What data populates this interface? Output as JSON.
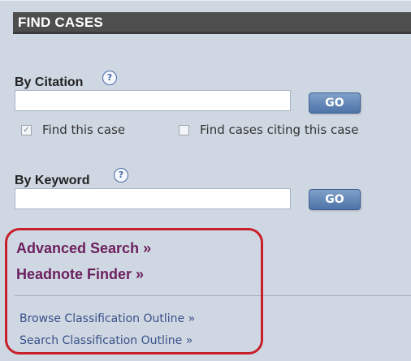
{
  "header": {
    "title": "FIND CASES"
  },
  "by_citation": {
    "label": "By Citation",
    "help_glyph": "?",
    "input_value": "",
    "go_label": "GO",
    "options": [
      {
        "label": "Find this case",
        "checked": true
      },
      {
        "label": "Find cases citing this case",
        "checked": false
      }
    ]
  },
  "by_keyword": {
    "label": "By Keyword",
    "help_glyph": "?",
    "input_value": "",
    "go_label": "GO"
  },
  "links": {
    "advanced_search": "Advanced Search »",
    "headnote_finder": "Headnote Finder »",
    "browse_outline": "Browse Classification Outline »",
    "search_outline": "Search Classification Outline »"
  },
  "colors": {
    "panel_bg": "#cfd8e2",
    "header_bg": "#4e4e4e",
    "link_primary": "#6b1f5e",
    "link_secondary": "#3a4f8a",
    "highlight": "#c8202b"
  }
}
